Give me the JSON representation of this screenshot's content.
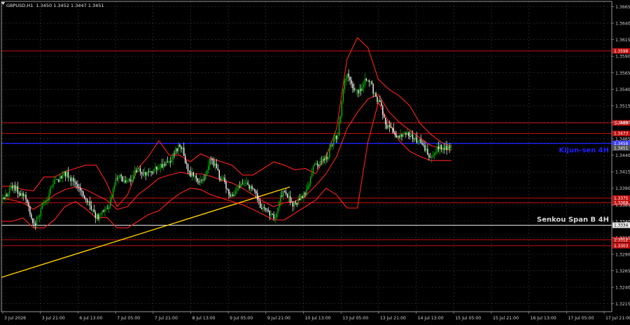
{
  "window": {
    "symbol_header": "GBPUSD,H1",
    "ohlc_header": "1.3450 1.3452 1.3447 1.3451"
  },
  "colors": {
    "background": "#000000",
    "grid": "#3a3a3a",
    "bull": "#00c000",
    "bear": "#ffffff",
    "bands": "#ff2020",
    "levels": "#c01010",
    "kijun": "#2020ff",
    "senkou": "#d8d8d8",
    "trend": "#ffd000",
    "axis_text": "#d0d0d0"
  },
  "chart_data": {
    "type": "candlestick",
    "price_axis_ticks": [
      "1.3665",
      "1.3640",
      "1.3615",
      "1.3590",
      "1.3565",
      "1.3540",
      "1.3515",
      "1.3490",
      "1.3465",
      "1.3440",
      "1.3415",
      "1.3390",
      "1.3365",
      "1.3340",
      "1.3315",
      "1.3290",
      "1.3265",
      "1.3240",
      "1.3215"
    ],
    "time_axis_ticks": [
      "3 Jul 2026",
      "3 Jul 21:00",
      "6 Jul 13:00",
      "7 Jul 05:00",
      "7 Jul 21:00",
      "8 Jul 13:00",
      "9 Jul 05:00",
      "9 Jul 21:00",
      "10 Jul 13:00",
      "13 Jul 05:00",
      "13 Jul 21:00",
      "14 Jul 13:00",
      "15 Jul 05:00",
      "15 Jul 21:00",
      "16 Jul 13:00",
      "17 Jul 05:00",
      "17 Jul 21:00"
    ],
    "ylim": [
      1.3203,
      1.3673
    ],
    "levels": [
      {
        "price": 1.3598,
        "label": "1.3598"
      },
      {
        "price": 1.3489,
        "label": "1.3489"
      },
      {
        "price": 1.3473,
        "label": "1.3473"
      },
      {
        "price": 1.3375,
        "label": "1.3375"
      },
      {
        "price": 1.3368,
        "label": "1.3368"
      },
      {
        "price": 1.3312,
        "label": "1.3312"
      },
      {
        "price": 1.3303,
        "label": "1.3303"
      }
    ],
    "kijun": {
      "price": 1.3458,
      "label": "1.3458",
      "name": "Kijun-sen 4H"
    },
    "senkou": {
      "price": 1.3334,
      "label": "1.3334",
      "name": "Senkou Span B 4H"
    },
    "current_price": {
      "price": 1.3451,
      "label": "1.3451"
    },
    "path_points": [
      1.3373,
      1.3392,
      1.3378,
      1.3336,
      1.3367,
      1.3401,
      1.3412,
      1.3398,
      1.3372,
      1.3346,
      1.3357,
      1.3408,
      1.3401,
      1.3417,
      1.3412,
      1.3422,
      1.3433,
      1.3454,
      1.3412,
      1.3398,
      1.3432,
      1.3405,
      1.3376,
      1.3398,
      1.3388,
      1.3358,
      1.3346,
      1.3385,
      1.3365,
      1.3382,
      1.3425,
      1.3436,
      1.3468,
      1.3562,
      1.3535,
      1.3557,
      1.3522,
      1.3481,
      1.3468,
      1.3472,
      1.3462,
      1.344,
      1.3452,
      1.3451
    ],
    "bands_upper": [
      1.3393,
      1.3393,
      1.3388,
      1.3386,
      1.3407,
      1.3407,
      1.3415,
      1.342,
      1.3425,
      1.3425,
      1.3398,
      1.3362,
      1.338,
      1.342,
      1.3438,
      1.3462,
      1.344,
      1.344,
      1.343,
      1.3442,
      1.3435,
      1.343,
      1.3425,
      1.341,
      1.341,
      1.342,
      1.343,
      1.3425,
      1.3418,
      1.342,
      1.3412,
      1.3438,
      1.348,
      1.3585,
      1.3618,
      1.3603,
      1.3555,
      1.354,
      1.353,
      1.3515,
      1.3488,
      1.3472,
      1.346,
      1.3453
    ],
    "bands_lower": [
      1.334,
      1.334,
      1.3345,
      1.333,
      1.333,
      1.3342,
      1.3362,
      1.337,
      1.3359,
      1.3345,
      1.3346,
      1.333,
      1.333,
      1.334,
      1.335,
      1.3356,
      1.337,
      1.3382,
      1.339,
      1.3388,
      1.338,
      1.3375,
      1.337,
      1.3365,
      1.3358,
      1.335,
      1.3342,
      1.3342,
      1.3352,
      1.3362,
      1.3372,
      1.339,
      1.338,
      1.336,
      1.336,
      1.346,
      1.352,
      1.349,
      1.3462,
      1.3446,
      1.3438,
      1.3432,
      1.3432,
      1.3432
    ],
    "bands_middle": [
      1.3375,
      1.3372,
      1.3368,
      1.3358,
      1.3368,
      1.338,
      1.3388,
      1.3392,
      1.3388,
      1.338,
      1.3372,
      1.3358,
      1.3362,
      1.338,
      1.3392,
      1.3405,
      1.341,
      1.3414,
      1.3412,
      1.3412,
      1.3408,
      1.3402,
      1.3398,
      1.339,
      1.338,
      1.337,
      1.3362,
      1.3368,
      1.337,
      1.3378,
      1.3394,
      1.3412,
      1.3438,
      1.348,
      1.3505,
      1.3525,
      1.3532,
      1.3506,
      1.349,
      1.3478,
      1.3466,
      1.3455,
      1.345,
      1.3448
    ],
    "trendline": {
      "from": 1.3255,
      "to": 1.3392
    }
  }
}
